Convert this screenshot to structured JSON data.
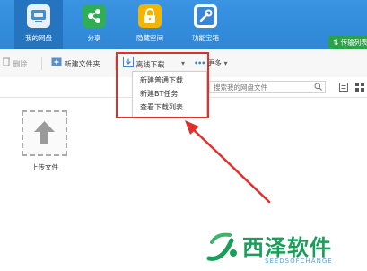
{
  "nav": {
    "items": [
      {
        "label": "我的网盘"
      },
      {
        "label": "分享"
      },
      {
        "label": "隐藏空间"
      },
      {
        "label": "功能宝箱"
      }
    ],
    "transfer_label": "传输列表"
  },
  "toolbar": {
    "delete_label": "删除",
    "new_folder_label": "新建文件夹",
    "offline_download_label": "离线下载",
    "more_label": "更多"
  },
  "search": {
    "placeholder": "搜索我的网盘文件"
  },
  "dropdown": {
    "items": [
      {
        "label": "新建普通下载"
      },
      {
        "label": "新建BT任务"
      },
      {
        "label": "查看下载列表"
      }
    ]
  },
  "upload": {
    "label": "上传文件"
  },
  "watermark": {
    "title": "西泽软件",
    "subtitle": "SEEDSOFCHANGE"
  },
  "colors": {
    "header_blue": "#2f86d6",
    "highlight_red": "#e0302b",
    "transfer_green": "#2aa248",
    "watermark_green": "#1a9e5a"
  }
}
